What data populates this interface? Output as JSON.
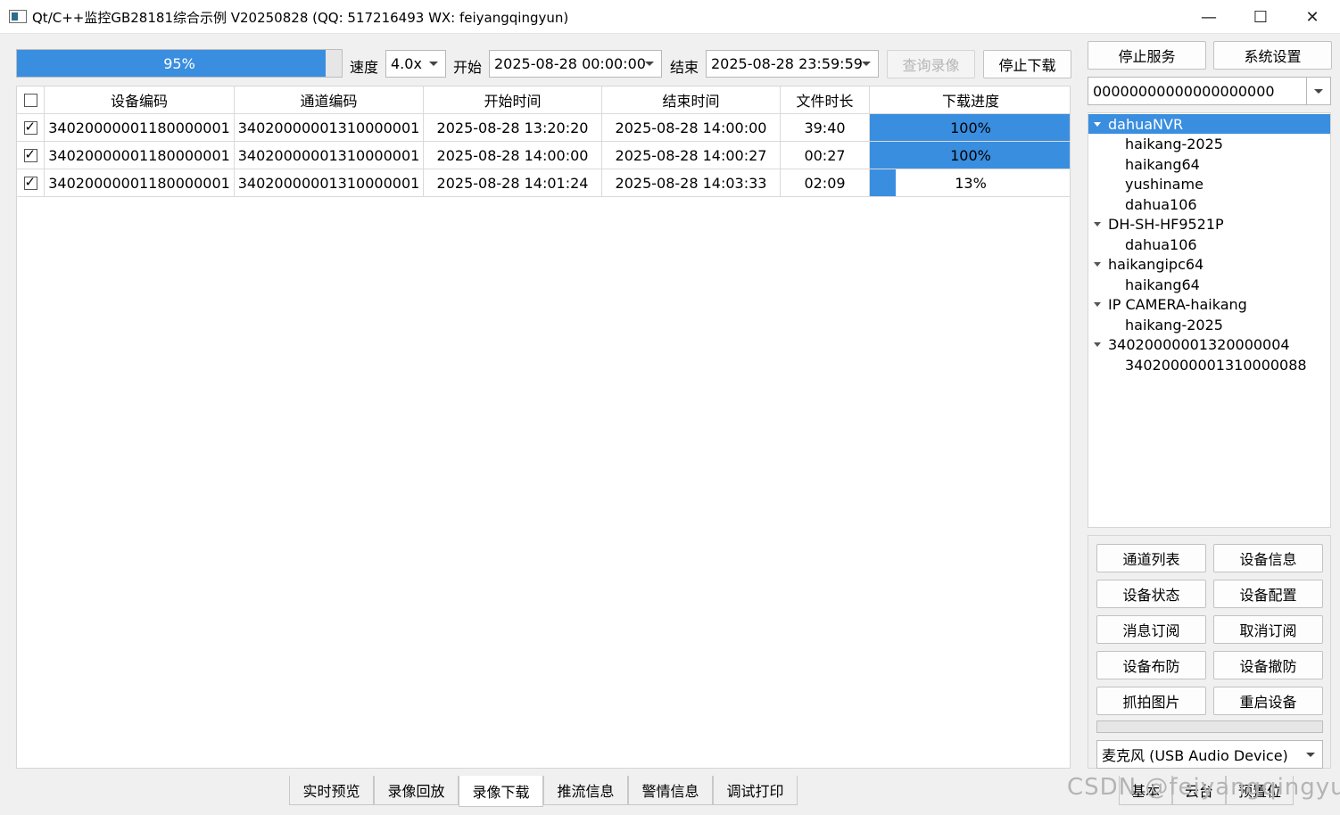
{
  "window": {
    "title": "Qt/C++监控GB28181综合示例 V20250828 (QQ: 517216493 WX: feiyangqingyun)",
    "controls": {
      "minimize": "—",
      "maximize": "☐",
      "close": "✕"
    }
  },
  "toolbar": {
    "progress": {
      "value": 0.95,
      "text": "95%"
    },
    "speed_label": "速度",
    "speed_value": "4.0x",
    "start_label": "开始",
    "start_value": "2025-08-28 00:00:00",
    "end_label": "结束",
    "end_value": "2025-08-28 23:59:59",
    "query_button": "查询录像",
    "stop_download_button": "停止下载"
  },
  "table": {
    "columns": [
      "设备编码",
      "通道编码",
      "开始时间",
      "结束时间",
      "文件时长",
      "下载进度"
    ],
    "rows": [
      {
        "checked": true,
        "device": "34020000001180000001",
        "channel": "34020000001310000001",
        "start": "2025-08-28 13:20:20",
        "end": "2025-08-28 14:00:00",
        "duration": "39:40",
        "progress": 1.0,
        "progress_text": "100%"
      },
      {
        "checked": true,
        "device": "34020000001180000001",
        "channel": "34020000001310000001",
        "start": "2025-08-28 14:00:00",
        "end": "2025-08-28 14:00:27",
        "duration": "00:27",
        "progress": 1.0,
        "progress_text": "100%"
      },
      {
        "checked": true,
        "device": "34020000001180000001",
        "channel": "34020000001310000001",
        "start": "2025-08-28 14:01:24",
        "end": "2025-08-28 14:03:33",
        "duration": "02:09",
        "progress": 0.13,
        "progress_text": "13%"
      }
    ]
  },
  "right_panel": {
    "stop_service_button": "停止服务",
    "system_settings_button": "系统设置",
    "device_id_value": "00000000000000000000",
    "tree": [
      {
        "label": "dahuaNVR",
        "level": 0,
        "expanded": true,
        "selected": true
      },
      {
        "label": "haikang-2025",
        "level": 1
      },
      {
        "label": "haikang64",
        "level": 1
      },
      {
        "label": "yushiname",
        "level": 1
      },
      {
        "label": "dahua106",
        "level": 1
      },
      {
        "label": "DH-SH-HF9521P",
        "level": 0,
        "expanded": true
      },
      {
        "label": "dahua106",
        "level": 1
      },
      {
        "label": "haikangipc64",
        "level": 0,
        "expanded": true
      },
      {
        "label": "haikang64",
        "level": 1
      },
      {
        "label": "IP CAMERA-haikang",
        "level": 0,
        "expanded": true
      },
      {
        "label": "haikang-2025",
        "level": 1
      },
      {
        "label": "34020000001320000004",
        "level": 0,
        "expanded": true
      },
      {
        "label": "34020000001310000088",
        "level": 1
      }
    ],
    "buttons": [
      "通道列表",
      "设备信息",
      "设备状态",
      "设备配置",
      "消息订阅",
      "取消订阅",
      "设备布防",
      "设备撤防",
      "抓拍图片",
      "重启设备"
    ],
    "audio_device": "麦克风 (USB Audio Device)",
    "side_tabs": [
      "基本",
      "云台",
      "预置位"
    ]
  },
  "bottom_tabs": [
    "实时预览",
    "录像回放",
    "录像下载",
    "推流信息",
    "警情信息",
    "调试打印"
  ],
  "active_bottom_tab": "录像下载",
  "watermark": "CSDN @feiyangqingyun",
  "colors": {
    "accent": "#3a8ee0"
  }
}
